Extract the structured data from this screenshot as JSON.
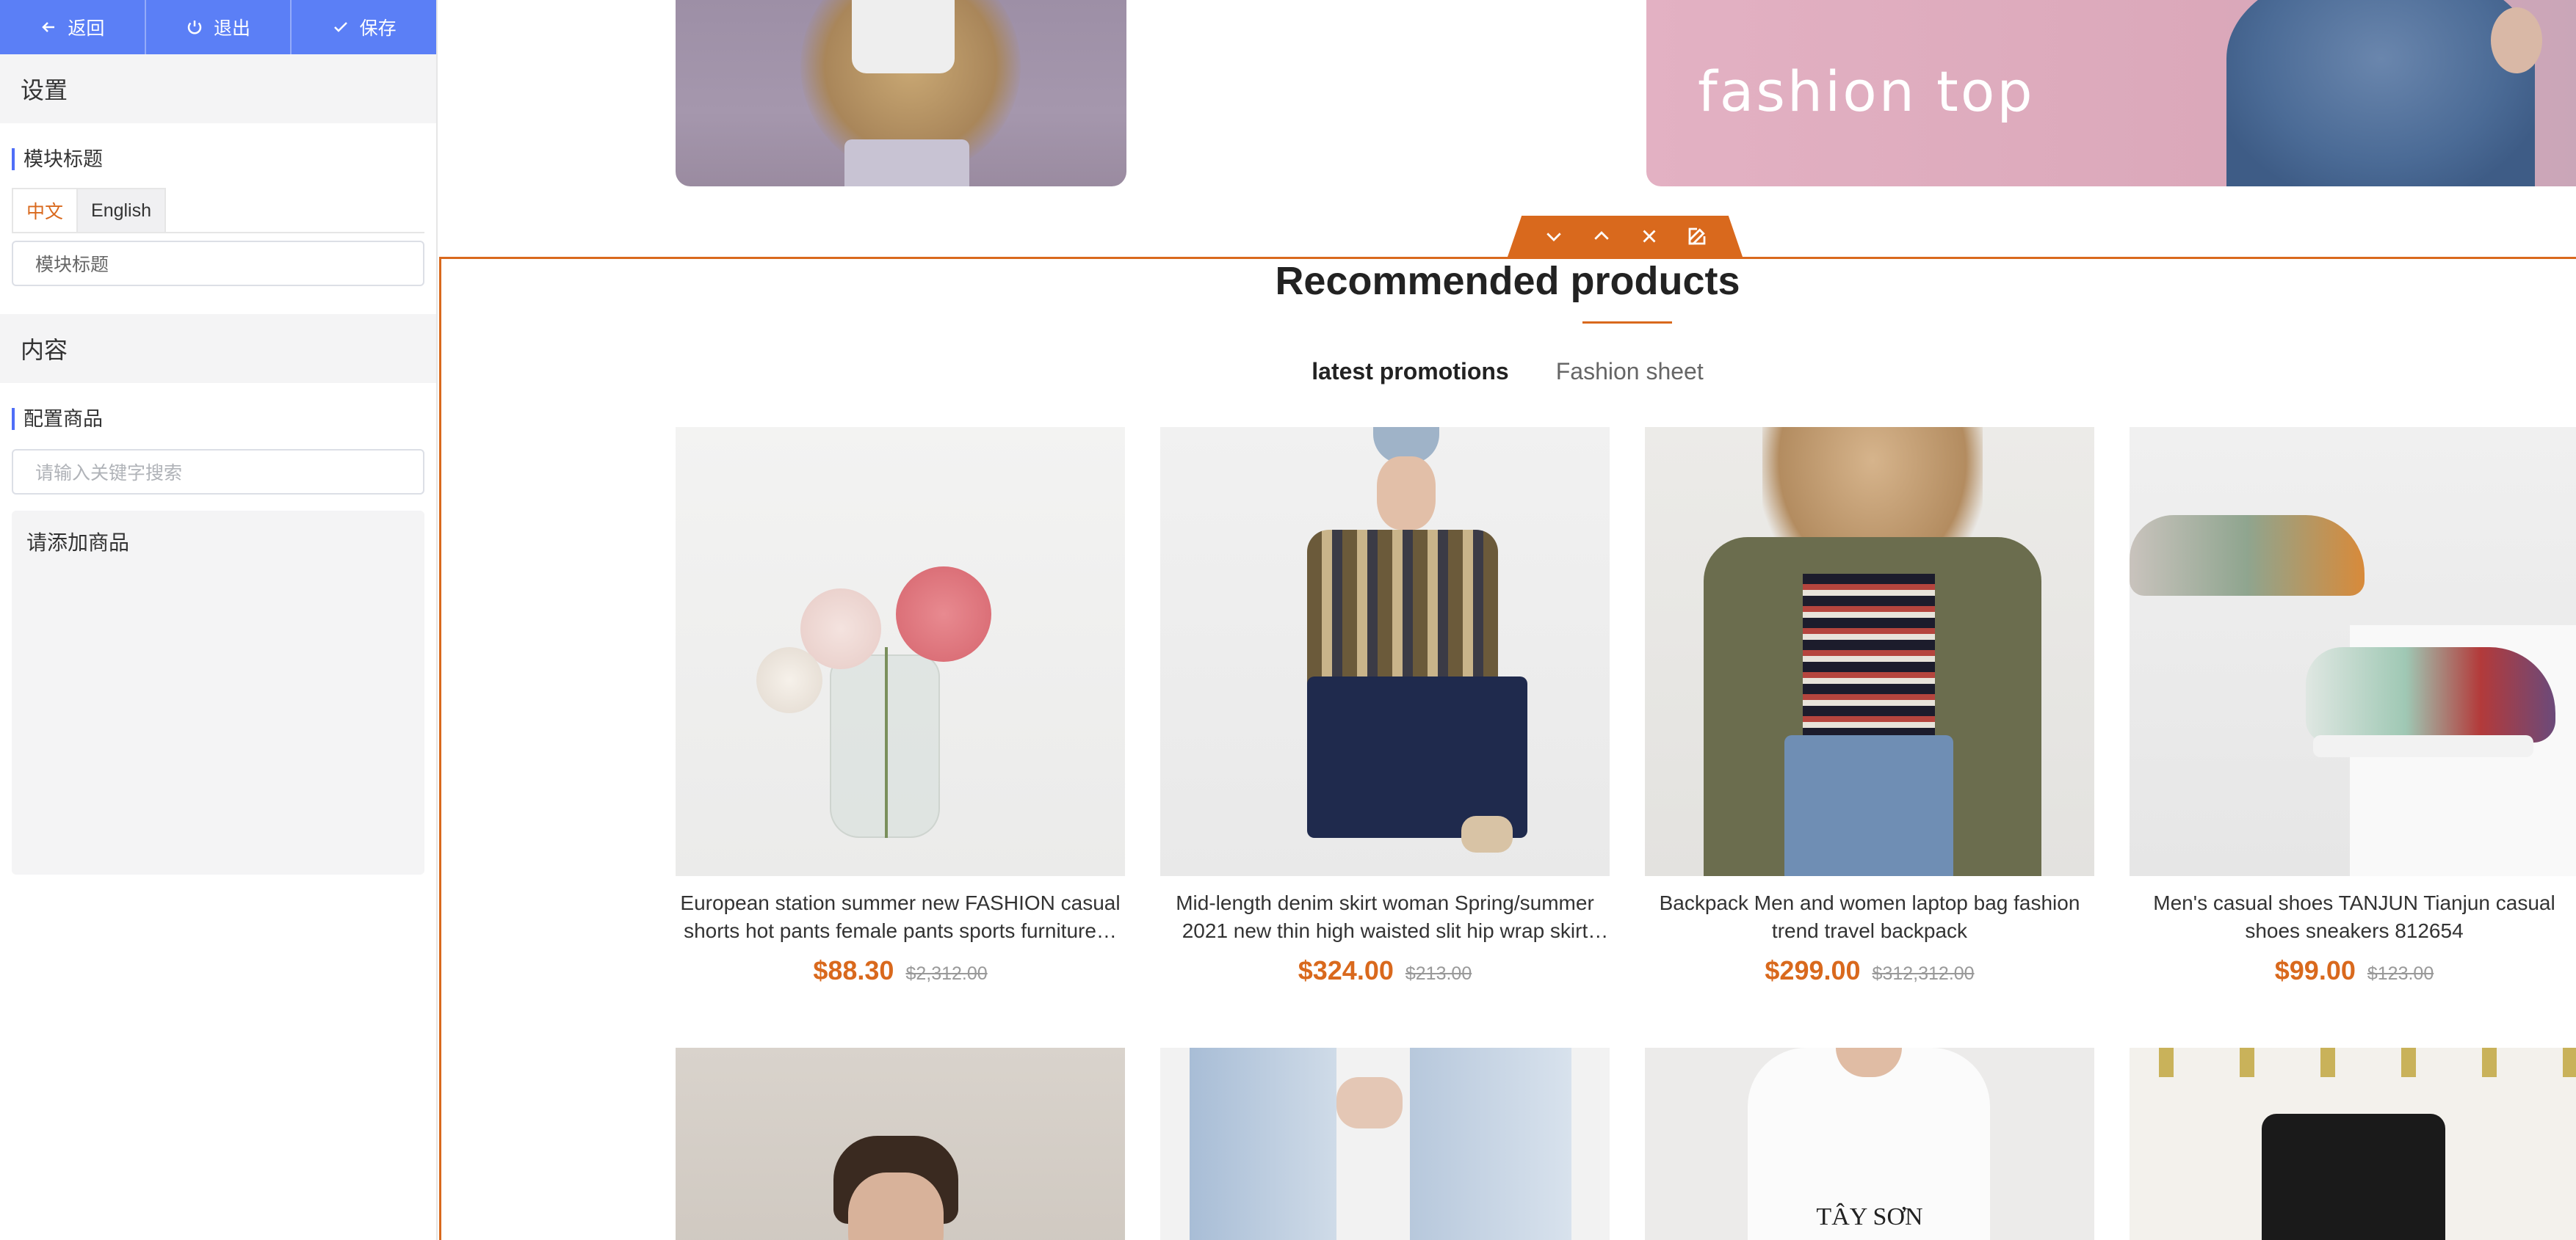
{
  "toolbar": {
    "back_label": "返回",
    "exit_label": "退出",
    "save_label": "保存",
    "accent": "#5b7ff6"
  },
  "settings": {
    "heading": "设置",
    "module_title_label": "模块标题",
    "lang_tabs": [
      "中文",
      "English"
    ],
    "module_title_value": "模块标题"
  },
  "content": {
    "heading": "内容",
    "config_label": "配置商品",
    "search_placeholder": "请输入关键字搜索",
    "empty_text": "请添加商品"
  },
  "banner": {
    "right_text": "fashion top"
  },
  "module": {
    "title": "Recommended products",
    "accent": "#d9691d",
    "tabs": [
      "latest promotions",
      "Fashion sheet"
    ],
    "products": [
      {
        "name": "European station summer new FASHION casual shorts hot pants female pants sports furniture…",
        "price": "$88.30",
        "old_price": "$2,312.00",
        "image": "flowers-in-vase"
      },
      {
        "name": "Mid-length denim skirt woman Spring/summer 2021 new thin high waisted slit hip wrap skirt A…",
        "price": "$324.00",
        "old_price": "$213.00",
        "image": "woman-plaid-jacket"
      },
      {
        "name": "Backpack Men and women laptop bag fashion trend travel backpack",
        "price": "$299.00",
        "old_price": "$312,312.00",
        "image": "woman-green-jacket"
      },
      {
        "name": "Men's casual shoes TANJUN Tianjun casual shoes sneakers 812654",
        "price": "$99.00",
        "old_price": "$123.00",
        "image": "sneakers"
      }
    ],
    "row2_text": "TÂY SƠN"
  }
}
